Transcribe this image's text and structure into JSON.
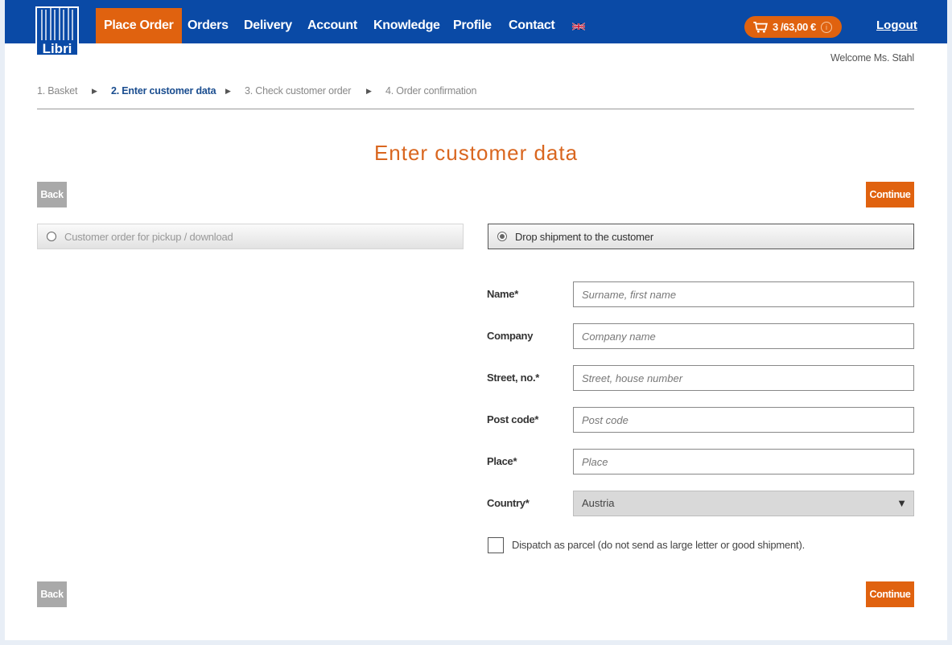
{
  "header": {
    "logo_text": "Libri",
    "nav": [
      "Place Order",
      "Orders",
      "Delivery",
      "Account",
      "Knowledge",
      "Profile",
      "Contact"
    ],
    "language_icon": "uk-flag-icon",
    "cart": {
      "label": "3 /63,00 €",
      "icon": "cart-icon",
      "info_glyph": "i"
    },
    "logout_label": "Logout",
    "welcome": "Welcome Ms. Stahl"
  },
  "steps": [
    {
      "label": "1. Basket",
      "state": "done"
    },
    {
      "label": "2. Enter customer data",
      "state": "current"
    },
    {
      "label": "3. Check customer order",
      "state": "upcoming"
    },
    {
      "label": "4. Order confirmation",
      "state": "upcoming"
    }
  ],
  "step_arrow": "▶",
  "page_title": "Enter customer data",
  "buttons": {
    "back": "Back",
    "continue": "Continue"
  },
  "options": {
    "pickup": {
      "label": "Customer order for pickup / download",
      "selected": false
    },
    "shipment": {
      "label": "Drop shipment to the customer",
      "selected": true
    }
  },
  "form": {
    "name": {
      "label": "Name*",
      "placeholder": "Surname, first name",
      "value": ""
    },
    "company": {
      "label": "Company",
      "placeholder": "Company name",
      "value": ""
    },
    "street": {
      "label": "Street, no.*",
      "placeholder": "Street, house number",
      "value": ""
    },
    "postcode": {
      "label": "Post code*",
      "placeholder": "Post code",
      "value": ""
    },
    "place": {
      "label": "Place*",
      "placeholder": "Place",
      "value": ""
    },
    "country": {
      "label": "Country*",
      "value": "Austria",
      "arrow": "▼"
    },
    "parcel_checkbox": {
      "label": "Dispatch as parcel (do not send as large letter or good shipment).",
      "checked": false
    }
  },
  "colors": {
    "header_blue": "#0a4aa6",
    "accent_orange": "#e0620f",
    "title_orange": "#d9661f",
    "current_step_blue": "#1a4d8f",
    "back_gray": "#a9a9a9"
  }
}
